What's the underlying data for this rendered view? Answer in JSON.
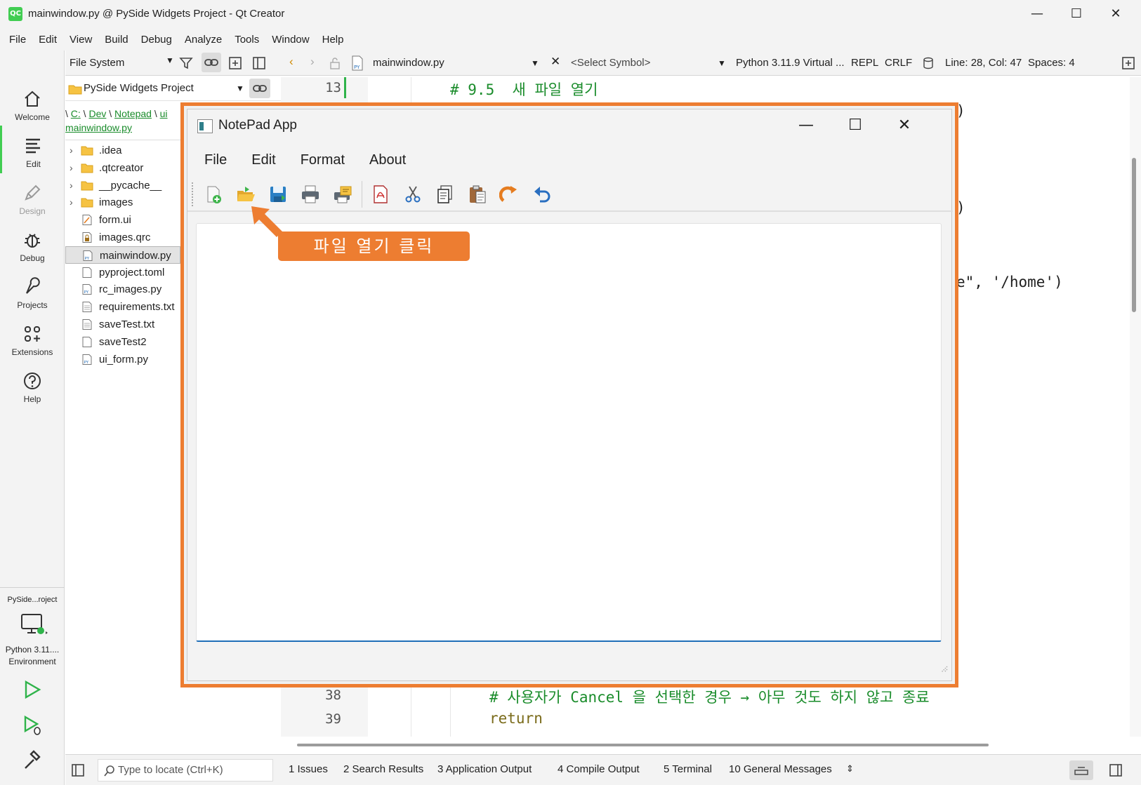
{
  "window": {
    "title": "mainwindow.py @ PySide Widgets Project - Qt Creator",
    "logo_text": "QC",
    "controls": {
      "minimize": "—",
      "maximize": "☐",
      "close": "✕"
    }
  },
  "menubar": [
    "File",
    "Edit",
    "View",
    "Build",
    "Debug",
    "Analyze",
    "Tools",
    "Window",
    "Help"
  ],
  "modes": [
    {
      "label": "Welcome",
      "icon": "home-icon"
    },
    {
      "label": "Edit",
      "icon": "edit-icon",
      "active": true
    },
    {
      "label": "Design",
      "icon": "pen-icon",
      "disabled": true
    },
    {
      "label": "Debug",
      "icon": "bug-icon"
    },
    {
      "label": "Projects",
      "icon": "wrench-icon"
    },
    {
      "label": "Extensions",
      "icon": "extensions-icon"
    },
    {
      "label": "Help",
      "icon": "help-icon"
    }
  ],
  "kit": {
    "project": "PySide...roject",
    "environment_line1": "Python 3.11....",
    "environment_line2": "Environment"
  },
  "file_panel": {
    "view_combo": "File System",
    "project_combo": "PySide Widgets Project",
    "breadcrumb": {
      "sep": "\\",
      "c": "C:",
      "dev": "Dev",
      "notepad": "Notepad",
      "ui": "ui",
      "file": "mainwindow.py"
    },
    "tree": [
      {
        "name": ".idea",
        "type": "folder",
        "expandable": true
      },
      {
        "name": ".qtcreator",
        "type": "folder",
        "expandable": true
      },
      {
        "name": "__pycache__",
        "type": "folder",
        "expandable": true
      },
      {
        "name": "images",
        "type": "folder",
        "expandable": true
      },
      {
        "name": "form.ui",
        "type": "ui"
      },
      {
        "name": "images.qrc",
        "type": "qrc"
      },
      {
        "name": "mainwindow.py",
        "type": "py",
        "selected": true
      },
      {
        "name": "pyproject.toml",
        "type": "file"
      },
      {
        "name": "rc_images.py",
        "type": "py"
      },
      {
        "name": "requirements.txt",
        "type": "txt"
      },
      {
        "name": "saveTest.txt",
        "type": "txt"
      },
      {
        "name": "saveTest2",
        "type": "file"
      },
      {
        "name": "ui_form.py",
        "type": "py"
      }
    ]
  },
  "editor_toolbar": {
    "document": "mainwindow.py",
    "symbol": "<Select Symbol>",
    "interpreter": "Python 3.11.9 Virtual ...",
    "repl": "REPL",
    "line_ending": "CRLF",
    "position": "Line: 28, Col: 47",
    "indent": "Spaces: 4"
  },
  "editor": {
    "lines": [
      {
        "num": "13",
        "text": "# 9.5  새 파일 열기"
      },
      {
        "num": "38",
        "text": "# 사용자가 Cancel 을 선택한 경우 → 아무 것도 하지 않고 종료"
      },
      {
        "num": "39",
        "text": "return"
      }
    ],
    "peek_1": ")",
    "peek_2": ")",
    "peek_3": "e\", '/home')"
  },
  "statusbar": {
    "locator_placeholder": "Type to locate (Ctrl+K)",
    "panes": [
      "1  Issues",
      "2  Search Results",
      "3  Application Output",
      "4  Compile Output",
      "5  Terminal",
      "10  General Messages"
    ]
  },
  "notepad": {
    "title": "NotePad App",
    "menu": [
      "File",
      "Edit",
      "Format",
      "About"
    ],
    "toolbar": [
      "new-file",
      "open-file",
      "save-file",
      "print",
      "print-preview",
      "export-pdf",
      "cut",
      "copy",
      "paste",
      "redo",
      "undo"
    ],
    "text_content": ""
  },
  "annotation": {
    "label": "파일 열기 클릭",
    "color": "#ed7d31"
  },
  "colors": {
    "accent_green": "#41cd52",
    "code_green": "#1a8c2b",
    "annotation_orange": "#ed7d31",
    "focus_blue": "#1f6fb8"
  }
}
